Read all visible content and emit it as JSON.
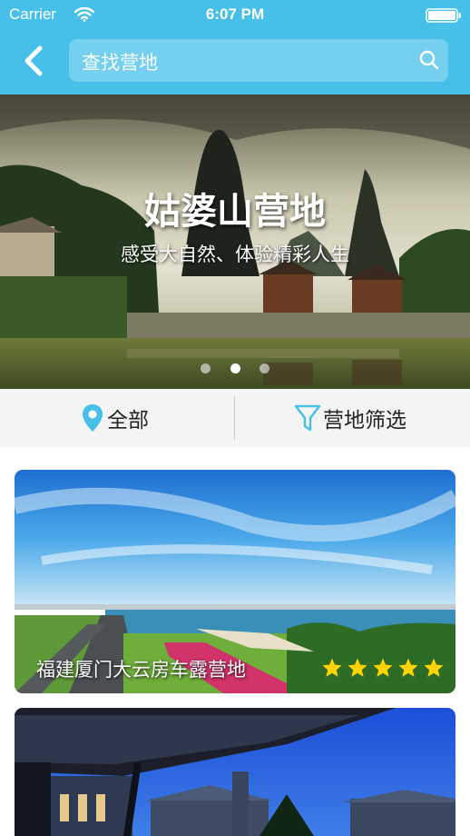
{
  "status_bar": {
    "carrier": "Carrier",
    "time": "6:07 PM"
  },
  "header": {
    "search_placeholder": "查找营地"
  },
  "banner": {
    "title": "姑婆山营地",
    "subtitle": "感受大自然、体验精彩人生",
    "page_count": 3,
    "active_page": 2
  },
  "filters": {
    "all_label": "全部",
    "filter_label": "营地筛选"
  },
  "camps": [
    {
      "name": "福建厦门大云房车露营地",
      "rating": 5
    },
    {
      "name": "",
      "rating": 0
    }
  ],
  "colors": {
    "header": "#46c0e8",
    "star": "#ffd400",
    "icon": "#46c0e8"
  }
}
